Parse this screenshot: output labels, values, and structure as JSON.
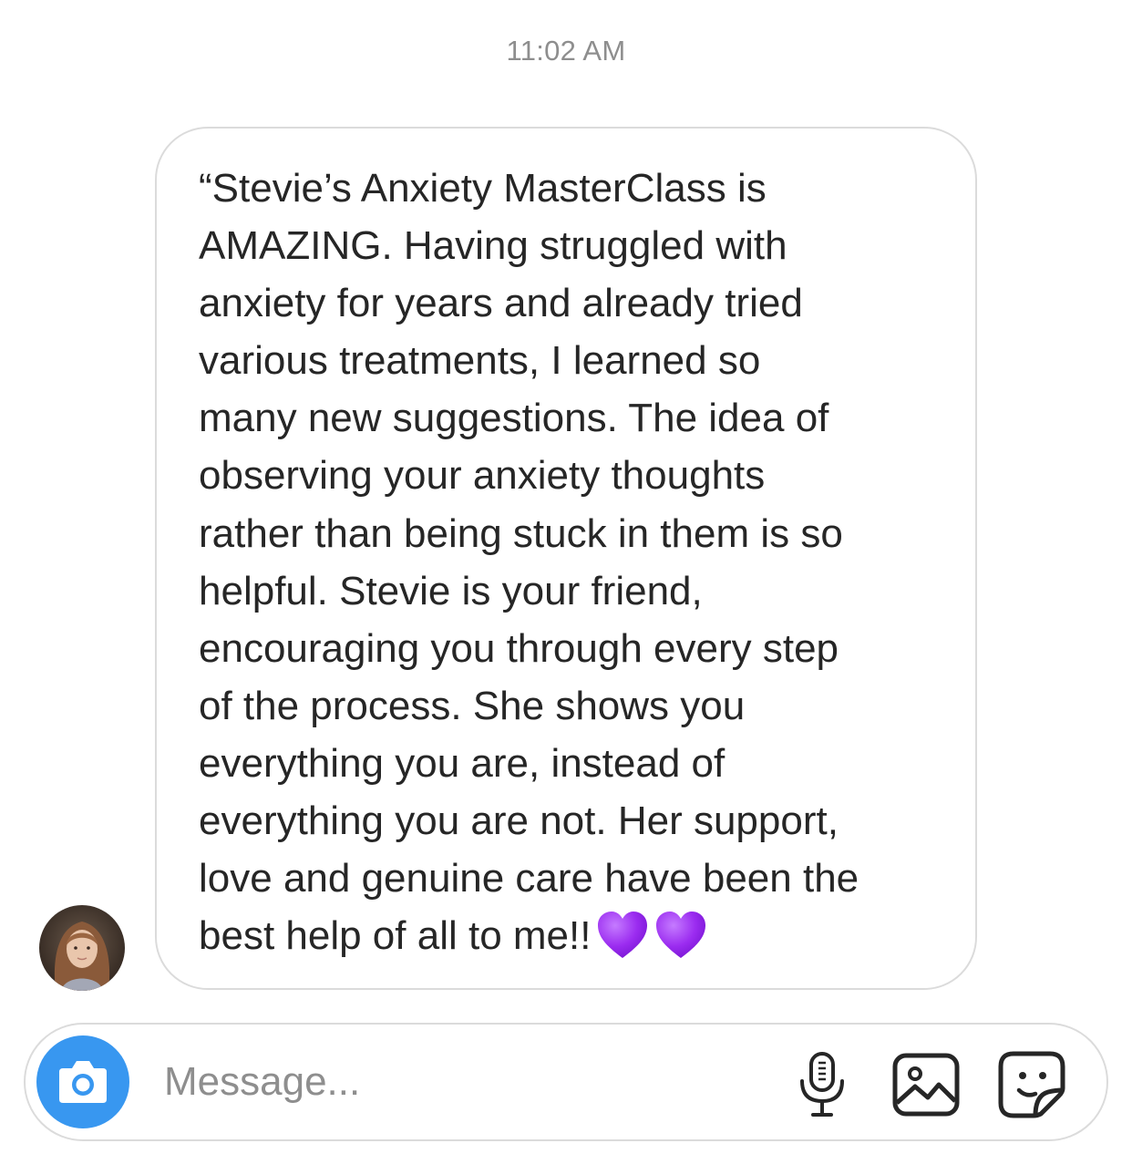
{
  "thread": {
    "timestamp": "11:02 AM"
  },
  "message": {
    "text": "“Stevie’s Anxiety MasterClass is\nAMAZING. Having struggled with\nanxiety for years and already tried\nvarious treatments, I learned so\nmany new suggestions. The idea of\nobserving your anxiety thoughts\nrather than being stuck in them is so\nhelpful. Stevie is your friend,\nencouraging you through every step\nof the process. She shows you\neverything you are, instead of\neverything you are not. Her support,\nlove and genuine care have been the\nbest help of all to me!!",
    "emoji": [
      "purple-heart",
      "purple-heart"
    ],
    "emoji_color": "#9b2cf0"
  },
  "composer": {
    "placeholder": "Message...",
    "value": "",
    "camera_icon": "camera-icon",
    "mic_icon": "microphone-icon",
    "photo_icon": "photo-gallery-icon",
    "sticker_icon": "sticker-icon",
    "accent_color": "#3897f0"
  }
}
